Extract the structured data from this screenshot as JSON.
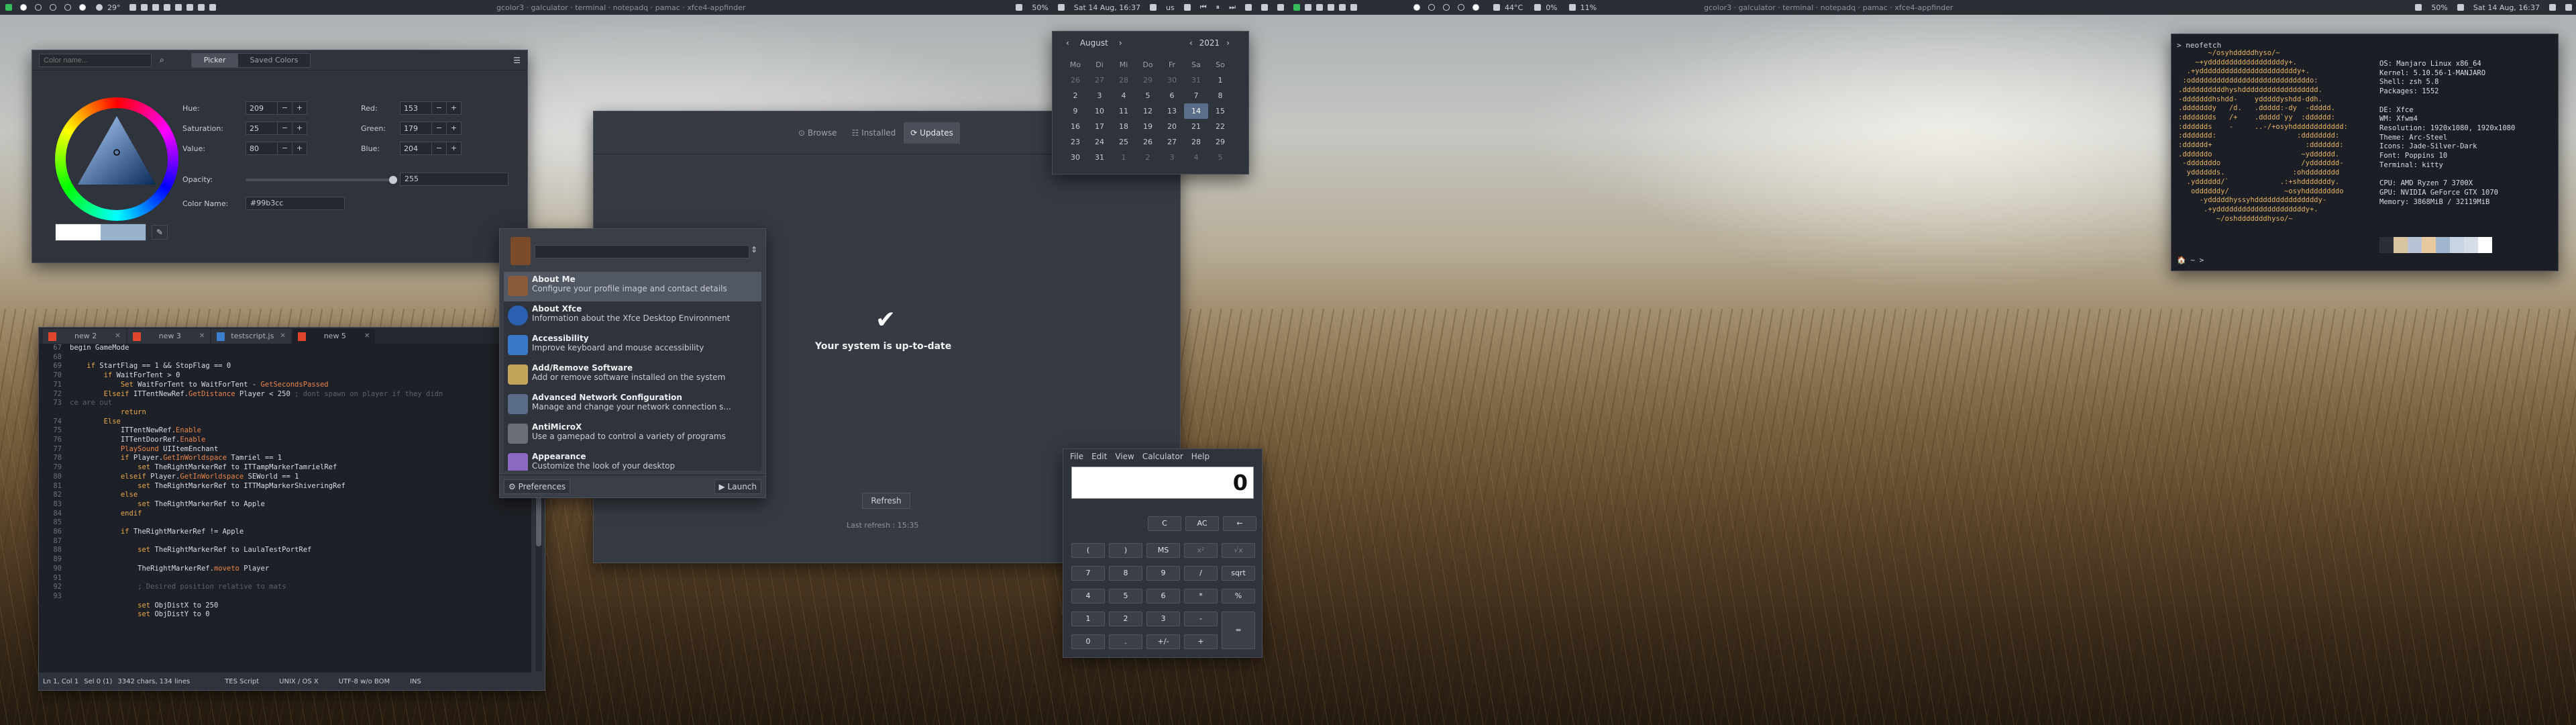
{
  "panel_left": {
    "temp": "29°",
    "tasks": "gcolor3 · galculator · terminal · notepadq · pamac · xfce4-appfinder",
    "volume": "50%",
    "date": "Sat 14 Aug, 16:37",
    "kb": "us",
    "pct": "50%"
  },
  "panel_right": {
    "temp": "44°C",
    "gpu": "0%",
    "load": "11%",
    "tasks": "gcolor3 · galculator · terminal · notepadq · pamac · xfce4-appfinder",
    "volume": "50%",
    "date": "Sat 14 Aug, 16:37"
  },
  "colorpicker": {
    "search_placeholder": "Color name...",
    "tab_picker": "Picker",
    "tab_saved": "Saved Colors",
    "hue_label": "Hue:",
    "hue": "209",
    "sat_label": "Saturation:",
    "sat": "25",
    "val_label": "Value:",
    "val": "80",
    "red_label": "Red:",
    "red": "153",
    "green_label": "Green:",
    "green": "179",
    "blue_label": "Blue:",
    "blue": "204",
    "opacity_label": "Opacity:",
    "opacity": "255",
    "name_label": "Color Name:",
    "name": "#99b3cc",
    "swatch": "#99b3cc"
  },
  "editor": {
    "tabs": [
      "new 2",
      "new 3",
      "testscript.js",
      "new 5"
    ],
    "status": {
      "pos": "Ln 1, Col 1",
      "sel": "Sel 0 (1)",
      "chars": "3342 chars, 134 lines",
      "lang": "TES Script",
      "eol": "UNIX / OS X",
      "enc": "UTF-8 w/o BOM",
      "ins": "INS"
    },
    "line_numbers": "67\n68\n69\n70\n71\n72\n73\n \n74\n75\n76\n77\n78\n79\n80\n81\n82\n83\n84\n85\n86\n87\n88\n89\n90\n91\n92\n93"
  },
  "pamac": {
    "browse": "Browse",
    "installed": "Installed",
    "updates": "Updates",
    "msg": "Your system is up-to-date",
    "refresh": "Refresh",
    "last": "Last refresh : 15:35"
  },
  "appfinder": {
    "items": [
      {
        "name": "About Me",
        "desc": "Configure your profile image and contact details"
      },
      {
        "name": "About Xfce",
        "desc": "Information about the Xfce Desktop Environment"
      },
      {
        "name": "Accessibility",
        "desc": "Improve keyboard and mouse accessibility"
      },
      {
        "name": "Add/Remove Software",
        "desc": "Add or remove software installed on the system"
      },
      {
        "name": "Advanced Network Configuration",
        "desc": "Manage and change your network connection s..."
      },
      {
        "name": "AntiMicroX",
        "desc": "Use a gamepad to control a variety of programs"
      },
      {
        "name": "Appearance",
        "desc": "Customize the look of your desktop"
      }
    ],
    "preferences": "Preferences",
    "launch": "Launch"
  },
  "calendar": {
    "month": "August",
    "year": "2021",
    "days": [
      "Mo",
      "Di",
      "Mi",
      "Do",
      "Fr",
      "Sa",
      "So"
    ],
    "rows": [
      [
        "26",
        "27",
        "28",
        "29",
        "30",
        "31",
        "1"
      ],
      [
        "2",
        "3",
        "4",
        "5",
        "6",
        "7",
        "8"
      ],
      [
        "9",
        "10",
        "11",
        "12",
        "13",
        "14",
        "15"
      ],
      [
        "16",
        "17",
        "18",
        "19",
        "20",
        "21",
        "22"
      ],
      [
        "23",
        "24",
        "25",
        "26",
        "27",
        "28",
        "29"
      ],
      [
        "30",
        "31",
        "1",
        "2",
        "3",
        "4",
        "5"
      ]
    ]
  },
  "calculator": {
    "menu": [
      "File",
      "Edit",
      "View",
      "Calculator",
      "Help"
    ],
    "display": "0",
    "keys": [
      [
        "C",
        "AC",
        "←"
      ],
      [
        "(",
        ")",
        "MS",
        "x²",
        "√x",
        "x^y"
      ],
      [
        "7",
        "8",
        "9",
        "/",
        "sqrt"
      ],
      [
        "4",
        "5",
        "6",
        "*",
        "%"
      ],
      [
        "1",
        "2",
        "3",
        "-",
        "="
      ],
      [
        "0",
        ".",
        "+/-",
        "+"
      ]
    ]
  },
  "terminal": {
    "prompt": "> neofetch",
    "prompt2": "🏠 ~ >",
    "logo": "       ~/osyhdddddhyso/~\n    ~+yddddddddddddddddddy+.\n  .+ydddddddddddddddddddddddy+.\n :oddddddddddddddddddddddddddddo:\n.ddddddddddhyshdddddddddddddddddd.\n-dddddddhshdd-    ydddddyshdd-ddh.\n.dddddddy   /d.   .ddddd:-dy  -ddddd.\n:ddddddds   /+    .ddddd`yy  :dddddd:\n:dddddds    -     ..-/+osyhdddddddddddd:\n:ddddddd:                   :dddddddd:\n:dddddd+                      :ddddddd:\n.ddddddo                     ~ydddddd.\n -dddddddo                   /yddddddd-\n  ydddddds.                :ohdddddddd\n  .ydddddd/`            .:+shdddddddy.\n   oddddddy/             ~osyhddddddddo\n     -ydddddhyssyhdddddddddddddddy-\n      .+ydddddddddddddddddddddy+.\n         ~/oshdddddddhyso/~",
    "info": "OS: Manjaro Linux x86_64\nKernel: 5.10.56-1-MANJARO\nShell: zsh 5.8\nPackages: 1552\n\nDE: Xfce\nWM: Xfwm4\nResolution: 1920x1080, 1920x1080\nTheme: Arc-Steel\nIcons: Jade-Silver-Dark\nFont: Poppins 10\nTerminal: kitty\n\nCPU: AMD Ryzen 7 3700X\nGPU: NVIDIA GeForce GTX 1070\nMemory: 3868MiB / 32119MiB",
    "palette": [
      "#2b2e35",
      "#d8c4a0",
      "#b9c3d6",
      "#e7c9a0",
      "#9fb4cf",
      "#c9d4e2",
      "#d7dde6",
      "#ffffff"
    ]
  }
}
